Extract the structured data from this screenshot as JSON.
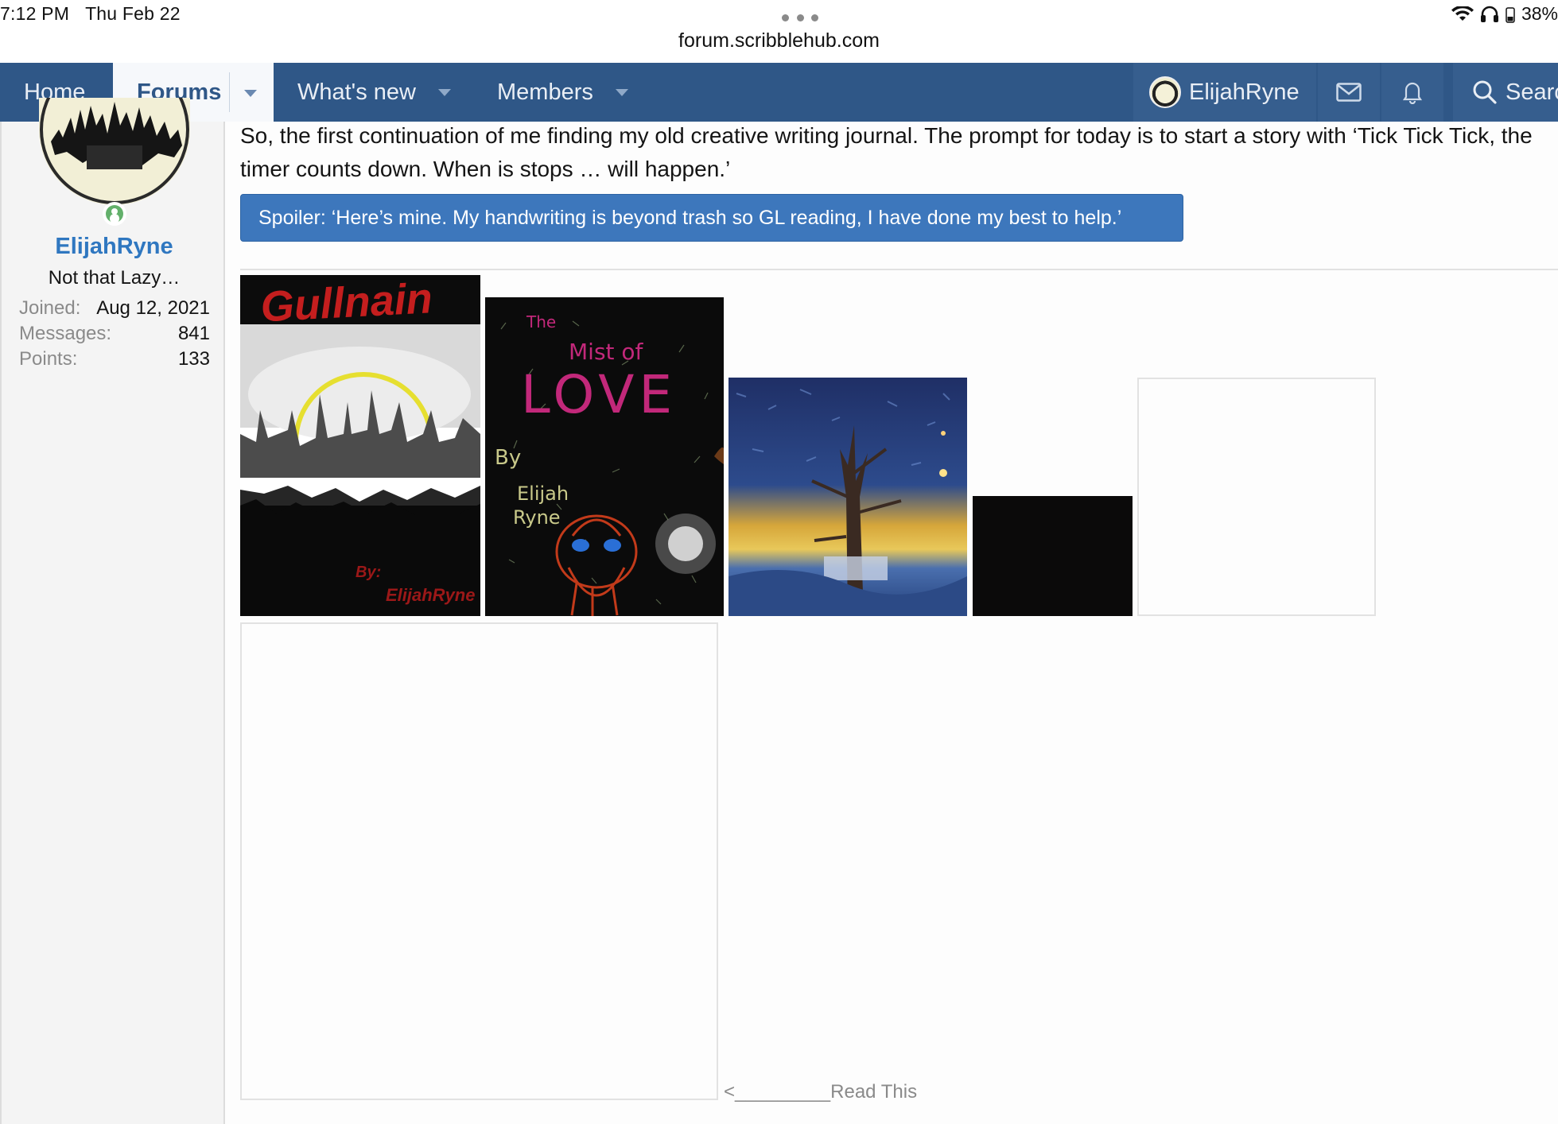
{
  "status_bar": {
    "time": "7:12 PM",
    "date": "Thu Feb 22",
    "url": "forum.scribblehub.com",
    "battery": "38%"
  },
  "nav": {
    "home": "Home",
    "forums": "Forums",
    "whats_new": "What's new",
    "members": "Members",
    "user": "ElijahRyne",
    "search": "Search",
    "accent": "#2f5787"
  },
  "sidebar": {
    "username": "ElijahRyne",
    "user_title": "Not that Lazy…",
    "stats": [
      {
        "key": "Joined:",
        "value": "Aug 12, 2021"
      },
      {
        "key": "Messages:",
        "value": "841"
      },
      {
        "key": "Points:",
        "value": "133"
      }
    ]
  },
  "post": {
    "body": "So, the first continuation of me finding my old creative writing journal. The prompt for today is to start a story with ‘Tick Tick Tick, the timer counts down. When is stops … will happen.’",
    "spoiler": "Spoiler: ‘Here’s mine. My handwriting is beyond trash so GL reading, I have done my best to help.’",
    "images": {
      "gullnain_title": "Gullnain",
      "gullnain_by": "By:",
      "gullnain_author": "ElijahRyne",
      "mist_the": "The",
      "mist_of": "Mist of",
      "mist_love": "LOVE",
      "mist_by": "By",
      "mist_author1": "Elijah",
      "mist_author2": "Ryne"
    },
    "read_this": "<_________Read This"
  }
}
